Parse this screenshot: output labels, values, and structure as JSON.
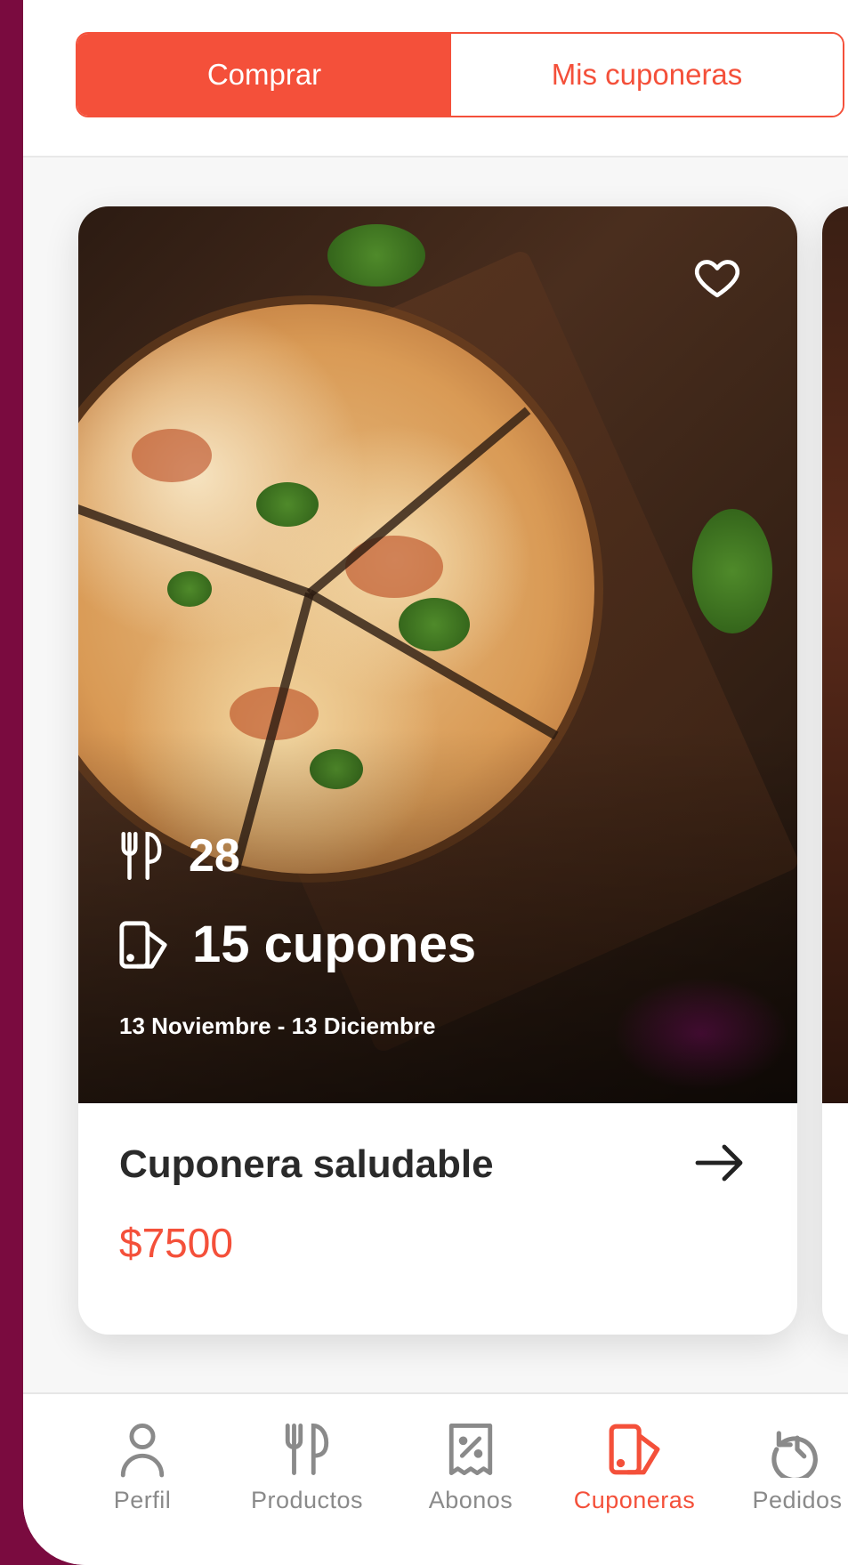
{
  "segmented": {
    "buy_label": "Comprar",
    "mine_label": "Mis cuponeras"
  },
  "card": {
    "restaurants_count": "28",
    "coupons_text": "15 cupones",
    "date_range": "13 Noviembre - 13 Diciembre",
    "title": "Cuponera saludable",
    "price": "$7500"
  },
  "tabbar": {
    "items": [
      {
        "label": "Perfil",
        "icon": "person-icon"
      },
      {
        "label": "Productos",
        "icon": "cutlery-icon"
      },
      {
        "label": "Abonos",
        "icon": "discount-receipt-icon"
      },
      {
        "label": "Cuponeras",
        "icon": "coupon-book-icon"
      },
      {
        "label": "Pedidos",
        "icon": "history-icon"
      }
    ],
    "active_index": 3
  },
  "colors": {
    "accent": "#f4503a",
    "background": "#7a0b3f",
    "tab_inactive": "#8a8a8a"
  }
}
